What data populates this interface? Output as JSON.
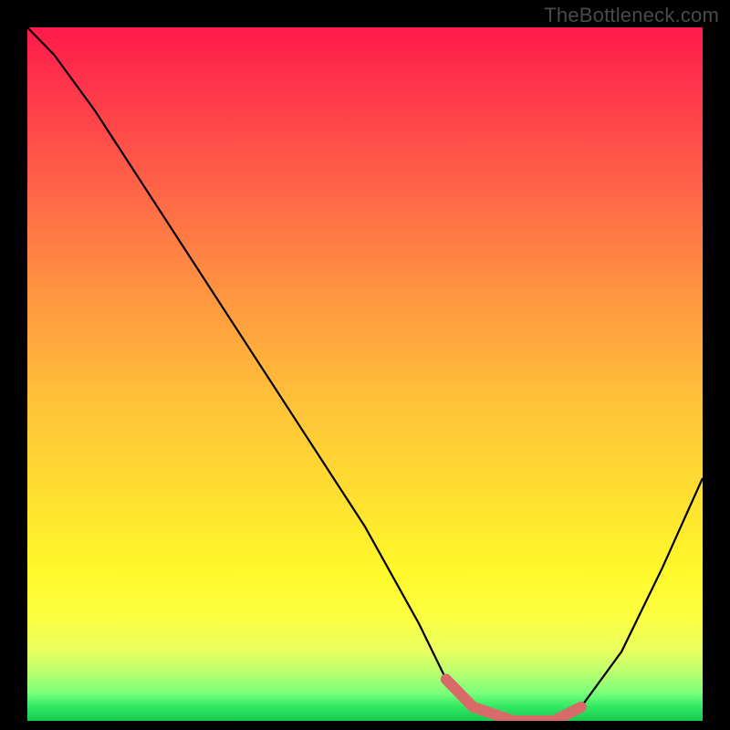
{
  "watermark": "TheBottleneck.com",
  "chart_data": {
    "type": "line",
    "title": "",
    "xlabel": "",
    "ylabel": "",
    "xlim": [
      0,
      100
    ],
    "ylim": [
      0,
      100
    ],
    "series": [
      {
        "name": "curve",
        "x": [
          0,
          4,
          10,
          20,
          30,
          40,
          50,
          58,
          62,
          66,
          72,
          78,
          82,
          88,
          94,
          100
        ],
        "values": [
          100,
          96,
          88,
          73,
          58,
          43,
          28,
          14,
          6,
          2,
          0,
          0,
          2,
          10,
          22,
          35
        ]
      }
    ],
    "highlight_range_x": [
      62,
      82
    ],
    "highlight_color": "#d86a6a",
    "background": "rainbow-vertical"
  }
}
